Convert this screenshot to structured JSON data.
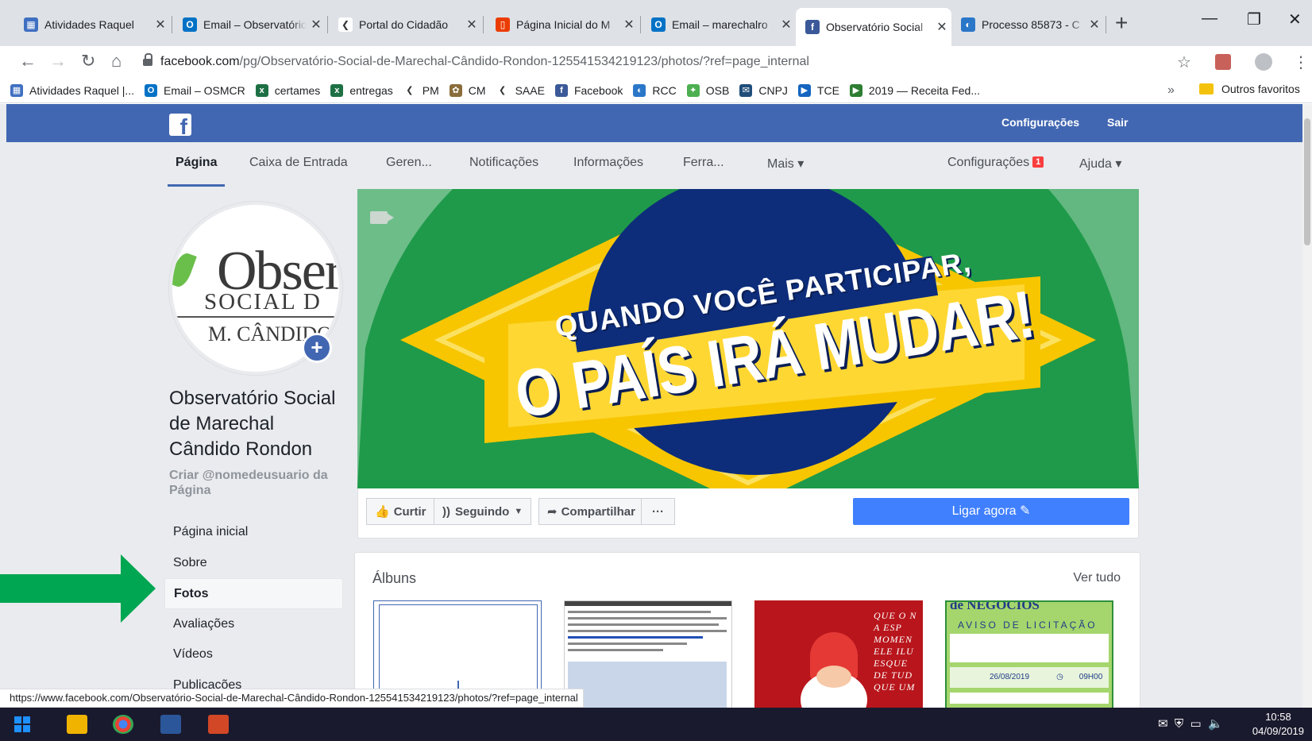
{
  "browser": {
    "tabs": [
      {
        "title": "Atividades Raquel",
        "favicon_color": "#3f6fc1",
        "favicon_glyph": "▦"
      },
      {
        "title": "Email – Observatório",
        "favicon_color": "#0072c6",
        "favicon_glyph": "O"
      },
      {
        "title": "Portal do Cidadão",
        "favicon_color": "#ffffff",
        "favicon_glyph": "❮"
      },
      {
        "title": "Página Inicial do M",
        "favicon_color": "#eb3c00",
        "favicon_glyph": "▯"
      },
      {
        "title": "Email – marechalro",
        "favicon_color": "#0072c6",
        "favicon_glyph": "O"
      },
      {
        "title": "Observatório Social",
        "favicon_color": "#3b5998",
        "favicon_glyph": "f",
        "active": true
      },
      {
        "title": "Processo 85873 - C",
        "favicon_color": "#2a77c9",
        "favicon_glyph": "◐"
      }
    ],
    "url": {
      "host": "facebook.com",
      "path": "/pg/Observatório-Social-de-Marechal-Cândido-Rondon-125541534219123/photos/?ref=page_internal"
    },
    "bookmarks": [
      {
        "label": "Atividades Raquel |...",
        "color": "#3f6fc1",
        "glyph": "▦"
      },
      {
        "label": "Email – OSMCR",
        "color": "#0072c6",
        "glyph": "O"
      },
      {
        "label": "certames",
        "color": "#1d7044",
        "glyph": "x"
      },
      {
        "label": "entregas",
        "color": "#1d7044",
        "glyph": "x"
      },
      {
        "label": "PM",
        "color": "#ffffff",
        "glyph": "❮"
      },
      {
        "label": "CM",
        "color": "#8a6d3b",
        "glyph": "✿"
      },
      {
        "label": "SAAE",
        "color": "#ffffff",
        "glyph": "❮"
      },
      {
        "label": "Facebook",
        "color": "#3b5998",
        "glyph": "f"
      },
      {
        "label": "RCC",
        "color": "#2a77c9",
        "glyph": "◐"
      },
      {
        "label": "OSB",
        "color": "#4caf50",
        "glyph": "✦"
      },
      {
        "label": "CNPJ",
        "color": "#1f4e79",
        "glyph": "✉"
      },
      {
        "label": "TCE",
        "color": "#1565c0",
        "glyph": "▶"
      },
      {
        "label": "2019 — Receita Fed...",
        "color": "#2e7d32",
        "glyph": "▶"
      }
    ],
    "other_bookmarks": "Outros favoritos",
    "more_bookmarks": "»",
    "status_url": "https://www.facebook.com/Observatório-Social-de-Marechal-Cândido-Rondon-125541534219123/photos/?ref=page_internal"
  },
  "facebook": {
    "top_links": {
      "settings": "Configurações",
      "logout": "Sair"
    },
    "page_tabs": {
      "page": "Página",
      "inbox": "Caixa de Entrada",
      "manage": "Geren...",
      "notifications": "Notificações",
      "insights": "Informações",
      "tools": "Ferra...",
      "more": "Mais ▾",
      "settings": "Configurações",
      "settings_badge": "1",
      "help": "Ajuda ▾"
    },
    "profile_logo": {
      "line1": "Obser",
      "line2": "SOCIAL D",
      "line3": "M. CÂNDIDO"
    },
    "page_name": "Observatório Social de Marechal Cândido Rondon",
    "username_prompt": "Criar @nomedeusuario da Página",
    "left_nav": [
      "Página inicial",
      "Sobre",
      "Fotos",
      "Avaliações",
      "Vídeos",
      "Publicações"
    ],
    "cover": {
      "line1": "QUANDO VOCÊ PARTICIPAR,",
      "line2": "O PAÍS IRÁ MUDAR!"
    },
    "actions": {
      "like": "Curtir",
      "following": "Seguindo",
      "share": "Compartilhar",
      "more": "···",
      "call": "Ligar agora ✎"
    },
    "albums": {
      "title": "Álbuns",
      "see_all": "Ver tudo",
      "thumb3_poem": "QUE O N A ESP MOMEN ELE ILU ESQUE DE TUD QUE UM",
      "thumb4_title": "de NEGÓCIOS",
      "thumb4_subtitle": "AVISO DE LICITAÇÃO",
      "thumb4_date": "26/08/2019",
      "thumb4_time": "09H00"
    }
  },
  "taskbar": {
    "time": "10:58",
    "date": "04/09/2019"
  }
}
